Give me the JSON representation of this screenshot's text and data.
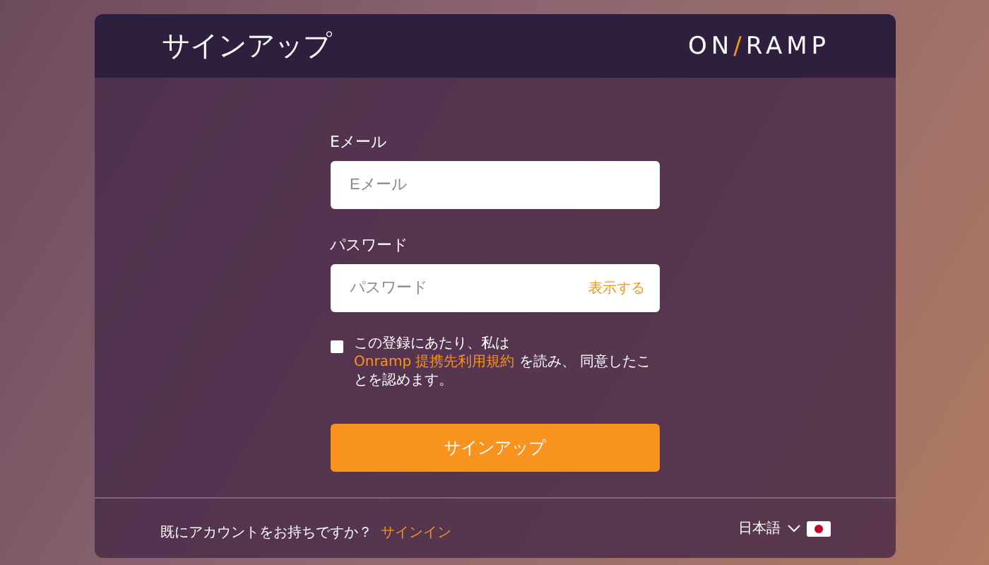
{
  "header": {
    "title": "サインアップ",
    "logo": {
      "left": "ON",
      "slash": "/",
      "right": "RAMP"
    }
  },
  "form": {
    "email": {
      "label": "Eメール",
      "placeholder": "Eメール"
    },
    "password": {
      "label": "パスワード",
      "placeholder": "パスワード",
      "toggle": "表示する"
    },
    "terms": {
      "checked": false,
      "before": "この登録にあたり、私は",
      "link": "Onramp 提携先利用規約",
      "after": "を読み、 同意したことを認めます。"
    },
    "submit": "サインアップ"
  },
  "footer": {
    "question": "既にアカウントをお持ちですか？",
    "signin": "サインイン",
    "language": "日本語"
  }
}
